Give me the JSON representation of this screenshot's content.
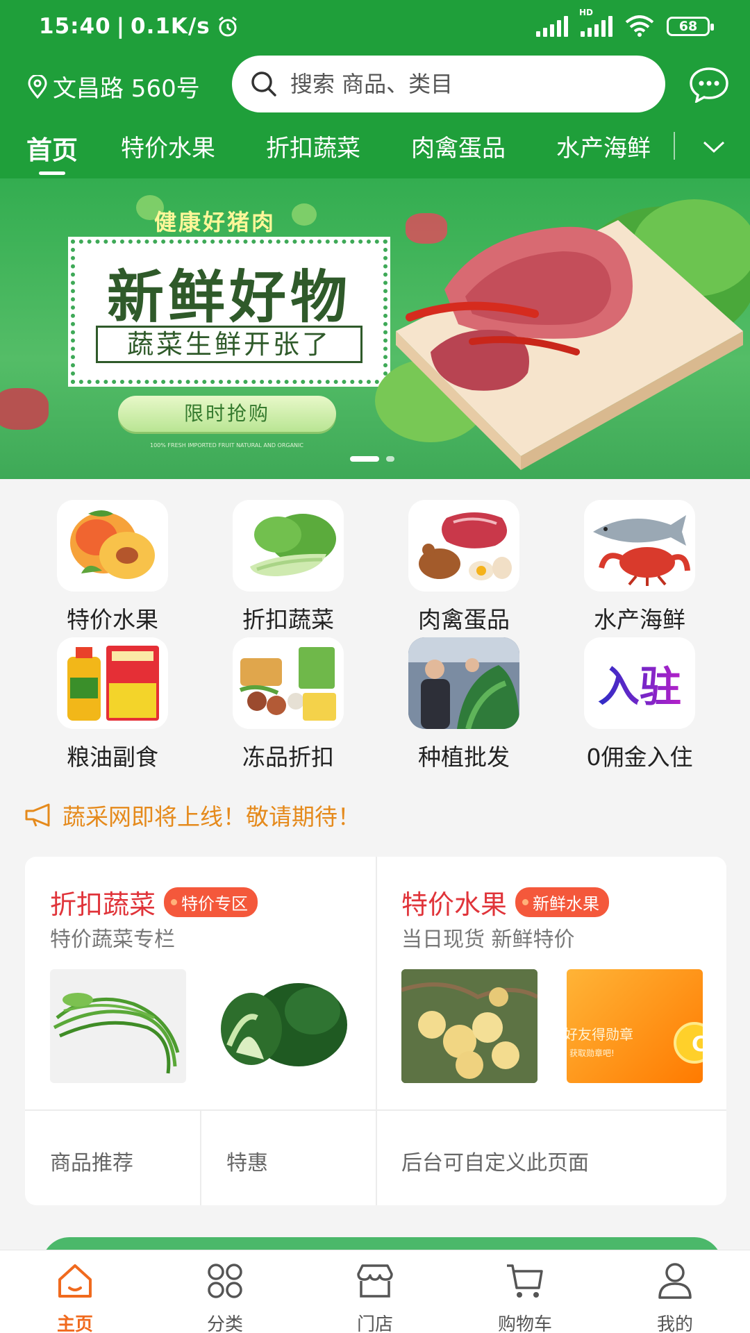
{
  "status_bar": {
    "time": "15:40",
    "speed": "0.1K/s",
    "network_tag": "HD",
    "battery": "68"
  },
  "header": {
    "location": "文昌路 560号",
    "search_placeholder": "搜索 商品、类目"
  },
  "category_tabs": [
    "首页",
    "特价水果",
    "折扣蔬菜",
    "肉禽蛋品",
    "水产海鲜"
  ],
  "banner": {
    "kicker": "健康好猪肉",
    "title": "新鲜好物",
    "subtitle": "蔬菜生鲜开张了",
    "button": "限时抢购",
    "fine_print": "100% FRESH IMPORTED FRUIT NATURAL AND ORGANIC"
  },
  "categories": [
    {
      "label": "特价水果",
      "icon": "peach-icon"
    },
    {
      "label": "折扣蔬菜",
      "icon": "bok-choy-icon"
    },
    {
      "label": "肉禽蛋品",
      "icon": "meat-egg-icon"
    },
    {
      "label": "水产海鲜",
      "icon": "seafood-icon"
    },
    {
      "label": "粮油副食",
      "icon": "grain-oil-icon"
    },
    {
      "label": "冻品折扣",
      "icon": "frozen-food-icon"
    },
    {
      "label": "种植批发",
      "icon": "planting-icon"
    },
    {
      "label": "0佣金入住",
      "icon": "join-icon",
      "icon_text": "入驻"
    }
  ],
  "notice": {
    "text": "蔬采网即将上线！敬请期待！"
  },
  "promo": {
    "left": {
      "title": "折扣蔬菜",
      "badge": "特价专区",
      "subtitle": "特价蔬菜专栏"
    },
    "right": {
      "title": "特价水果",
      "badge": "新鲜水果",
      "subtitle": "当日现货 新鲜特价",
      "ad_text": "好友得勋章",
      "ad_sub": "获取勋章吧!"
    },
    "links": [
      "商品推荐",
      "特惠",
      "后台可自定义此页面"
    ]
  },
  "bottom_nav": [
    {
      "label": "主页",
      "icon": "home-icon",
      "active": true
    },
    {
      "label": "分类",
      "icon": "category-icon"
    },
    {
      "label": "门店",
      "icon": "store-icon"
    },
    {
      "label": "购物车",
      "icon": "cart-icon"
    },
    {
      "label": "我的",
      "icon": "profile-icon"
    }
  ],
  "colors": {
    "brand_green": "#1f9f3a",
    "notice_orange": "#e58a1c",
    "promo_red": "#e0343a",
    "badge_orange": "#f4583b",
    "nav_active": "#f06a1e"
  }
}
